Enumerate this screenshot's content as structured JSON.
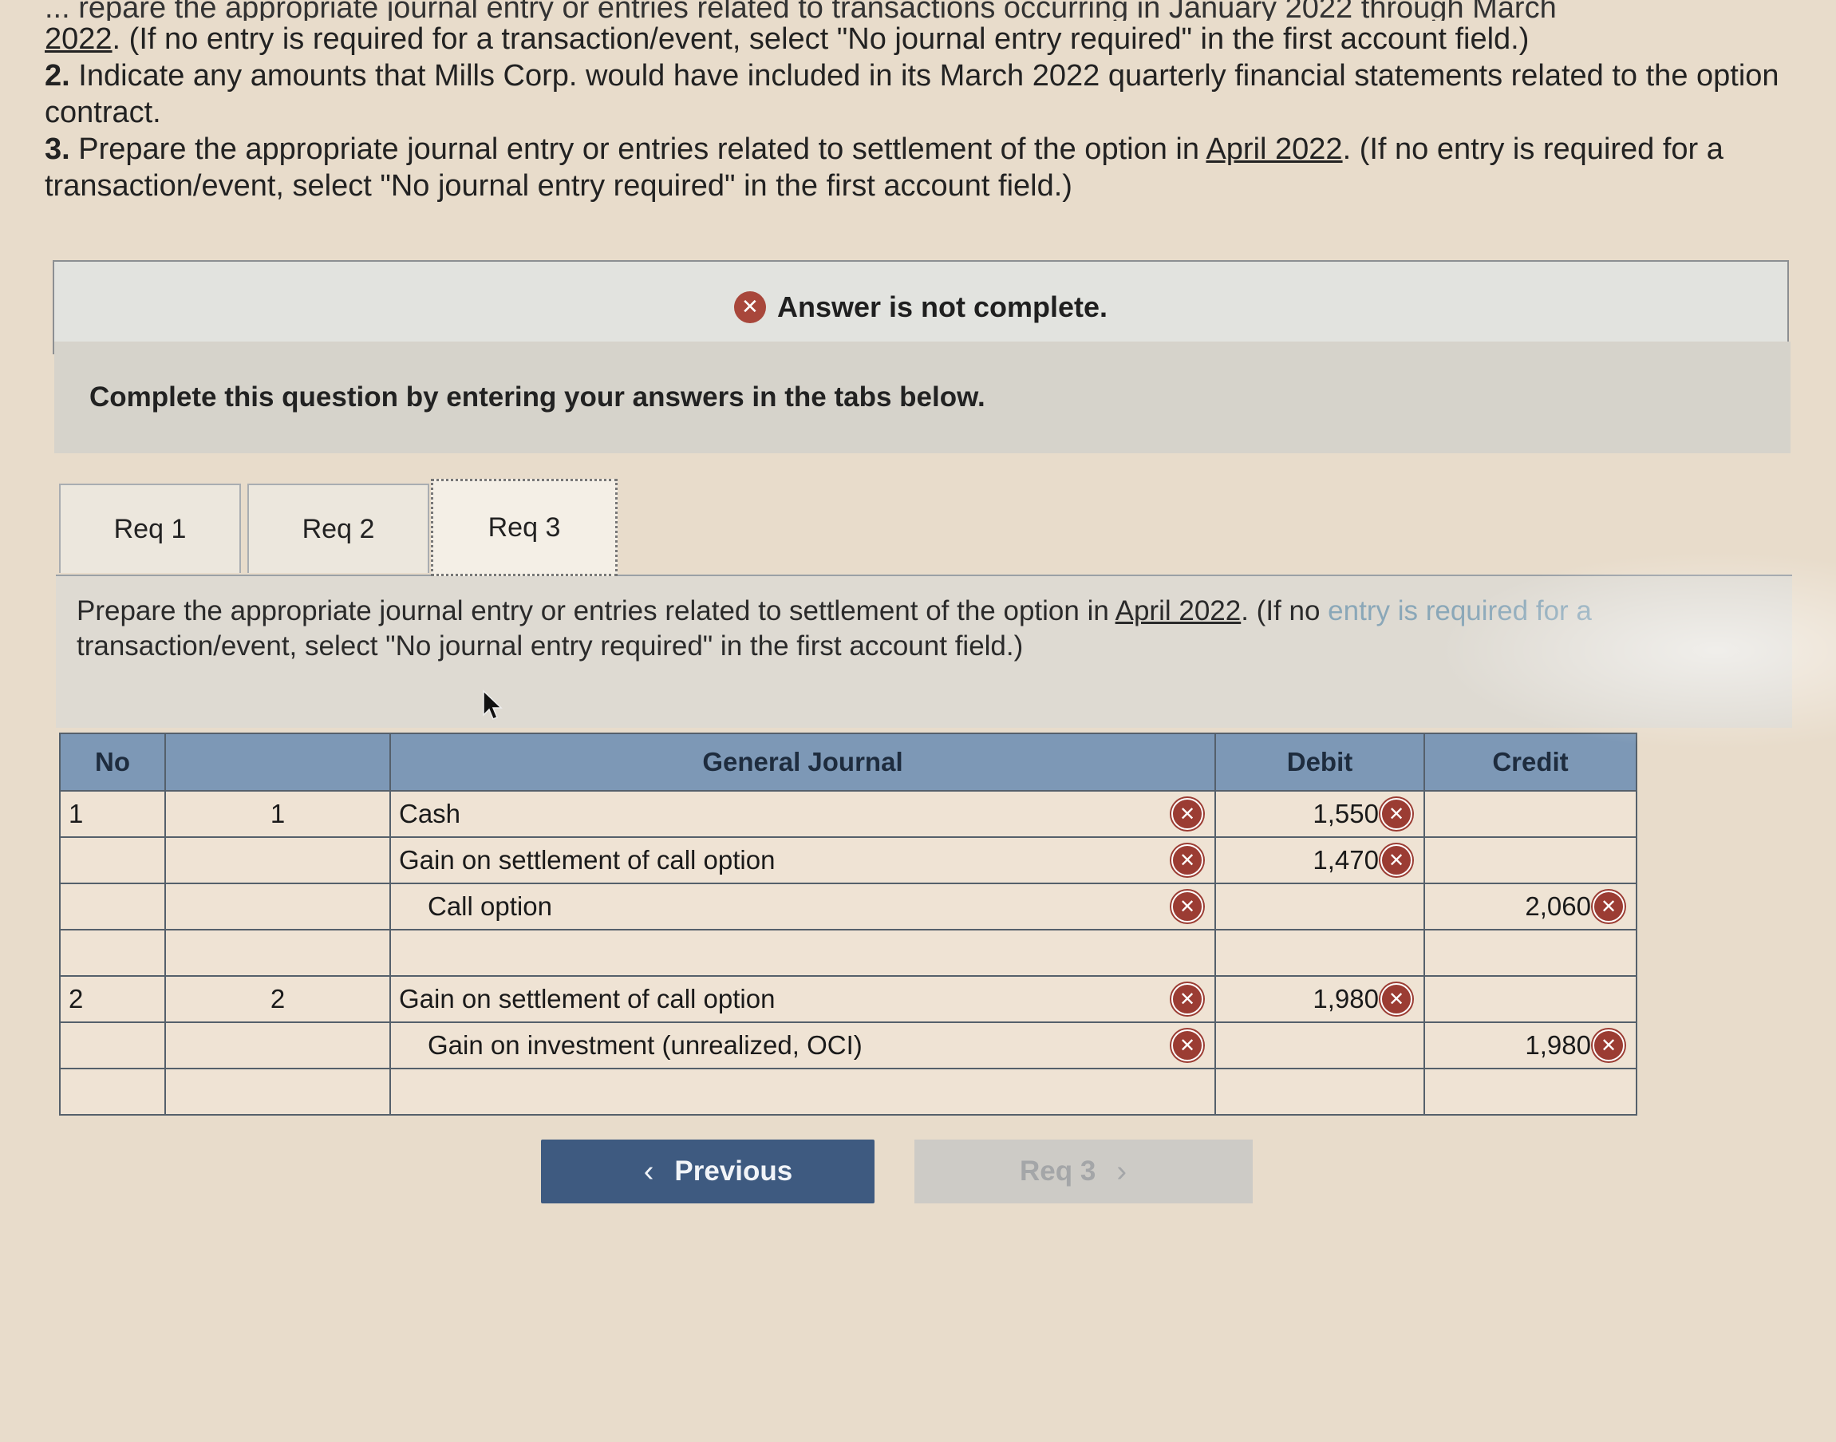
{
  "instructions": {
    "top_cut": "... repare the appropriate journal entry or entries related to transactions occurring in January 2022 through March",
    "line1_link": "2022",
    "line1_rest": ". (If no entry is required for a transaction/event, select \"No journal entry required\" in the first account field.)",
    "item2_num": "2.",
    "item2_text": " Indicate any amounts that Mills Corp. would have included in its March 2022 quarterly financial statements related to the option contract.",
    "item3_num": "3.",
    "item3_pre": " Prepare the appropriate journal entry or entries related to settlement of the option in ",
    "item3_link": "April 2022",
    "item3_post": ". (If no entry is required for a transaction/event, select \"No journal entry required\" in the first account field.)"
  },
  "status": {
    "text": "Answer is not complete.",
    "icon": "x-circle-icon",
    "icon_color": "#a8473b"
  },
  "complete_prompt": "Complete this question by entering your answers in the tabs below.",
  "tabs": [
    {
      "label": "Req 1",
      "active": false
    },
    {
      "label": "Req 2",
      "active": false
    },
    {
      "label": "Req 3",
      "active": true
    }
  ],
  "panel": {
    "pre": "Prepare the appropriate journal entry or entries related to settlement of the option in ",
    "link": "April 2022",
    "mid": ". (If no ",
    "faint": "entry is required for a",
    "post": "transaction/event, select \"No journal entry required\" in the first account field.)"
  },
  "journal": {
    "headers": {
      "no": "No",
      "date": "",
      "account": "General Journal",
      "debit": "Debit",
      "credit": "Credit"
    },
    "header_color": "#7d98b6",
    "rows": [
      {
        "no": "1",
        "date": "1",
        "account": "Cash",
        "indent": false,
        "debit": "1,550",
        "credit": "",
        "acct_x": true
      },
      {
        "no": "",
        "date": "",
        "account": "Gain on settlement of call option",
        "indent": false,
        "debit": "1,470",
        "credit": "",
        "acct_x": true
      },
      {
        "no": "",
        "date": "",
        "account": "Call option",
        "indent": true,
        "debit": "",
        "credit": "2,060",
        "acct_x": true
      },
      {
        "no": "",
        "date": "",
        "account": "",
        "indent": false,
        "debit": "",
        "credit": "",
        "acct_x": false
      },
      {
        "no": "2",
        "date": "2",
        "account": "Gain on settlement of call option",
        "indent": false,
        "debit": "1,980",
        "credit": "",
        "acct_x": true
      },
      {
        "no": "",
        "date": "",
        "account": "Gain on investment (unrealized, OCI)",
        "indent": true,
        "debit": "",
        "credit": "1,980",
        "acct_x": true
      },
      {
        "no": "",
        "date": "",
        "account": "",
        "indent": false,
        "debit": "",
        "credit": "",
        "acct_x": false
      }
    ]
  },
  "buttons": {
    "previous": "Previous",
    "previous_icon": "chevron-left-icon",
    "next": "Req 3",
    "next_icon": "chevron-right-icon",
    "previous_color": "#3e5a80"
  }
}
